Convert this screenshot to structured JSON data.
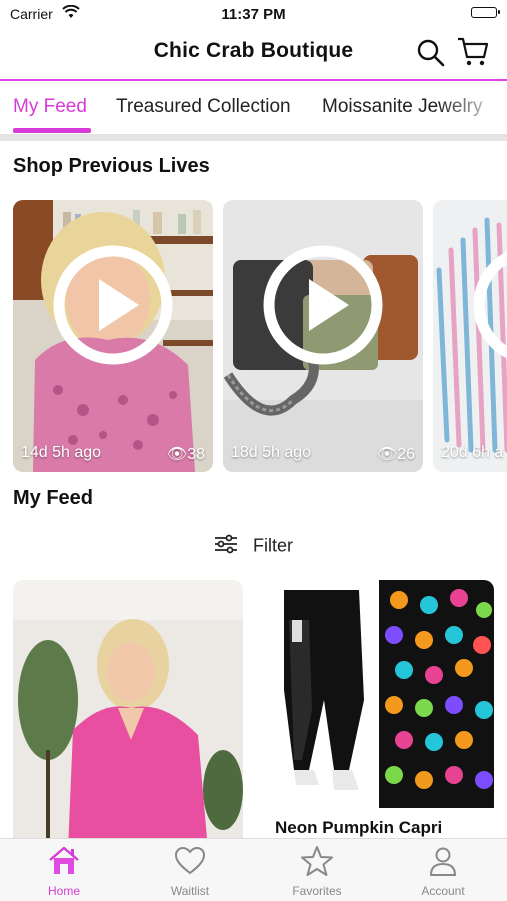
{
  "status": {
    "carrier": "Carrier",
    "time": "11:37 PM"
  },
  "header": {
    "title": "Chic Crab Boutique",
    "search_icon": "search-icon",
    "cart_icon": "cart-icon"
  },
  "tabs": [
    {
      "label": "My Feed",
      "active": true
    },
    {
      "label": "Treasured Collection",
      "active": false
    },
    {
      "label": "Moissanite Jewelry",
      "active": false
    }
  ],
  "sections": {
    "previous_lives": "Shop Previous Lives",
    "my_feed": "My Feed"
  },
  "lives": [
    {
      "time": "14d 5h ago",
      "views": "38"
    },
    {
      "time": "18d 5h ago",
      "views": "26"
    },
    {
      "time": "20d 6h a",
      "views": ""
    }
  ],
  "filter": {
    "label": "Filter"
  },
  "products": [
    {
      "name": ""
    },
    {
      "name": "Neon Pumpkin Capri"
    }
  ],
  "tabbar": [
    {
      "label": "Home",
      "icon": "home-icon",
      "active": true
    },
    {
      "label": "Waitlist",
      "icon": "heart-icon",
      "active": false
    },
    {
      "label": "Favorites",
      "icon": "star-icon",
      "active": false
    },
    {
      "label": "Account",
      "icon": "account-icon",
      "active": false
    }
  ],
  "colors": {
    "accent": "#d63bd8",
    "divider": "#e4e4e4"
  }
}
